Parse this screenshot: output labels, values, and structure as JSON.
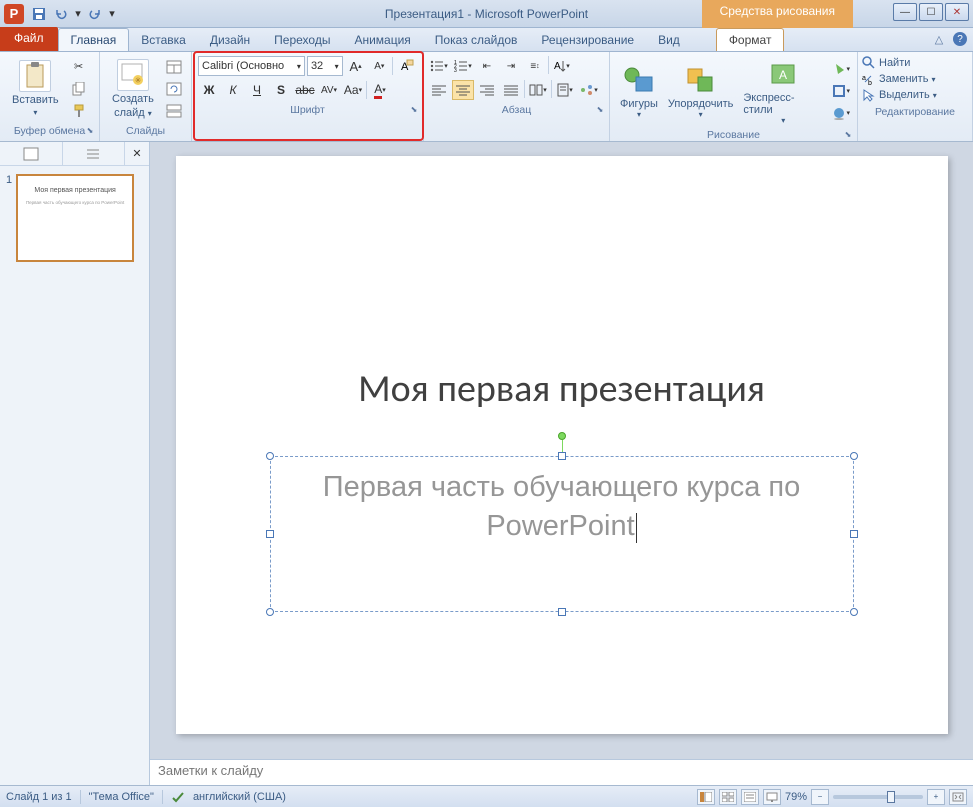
{
  "app_icon_letter": "P",
  "title": "Презентация1 - Microsoft PowerPoint",
  "context_tab": "Средства рисования",
  "tabs": {
    "file": "Файл",
    "list": [
      "Главная",
      "Вставка",
      "Дизайн",
      "Переходы",
      "Анимация",
      "Показ слайдов",
      "Рецензирование",
      "Вид"
    ],
    "format": "Формат"
  },
  "groups": {
    "clipboard": {
      "label": "Буфер обмена",
      "paste": "Вставить"
    },
    "slides": {
      "label": "Слайды",
      "new": "Создать",
      "slide": "слайд"
    },
    "font": {
      "label": "Шрифт",
      "family": "Calibri (Основно",
      "size": "32",
      "bold": "Ж",
      "italic": "К",
      "underline": "Ч",
      "strike": "abc",
      "shadow": "S",
      "spacing": "AV",
      "case": "Aa",
      "grow": "A",
      "shrink": "A",
      "clear": "A"
    },
    "paragraph": {
      "label": "Абзац"
    },
    "drawing": {
      "label": "Рисование",
      "shapes": "Фигуры",
      "arrange": "Упорядочить",
      "styles": "Экспресс-стили"
    },
    "editing": {
      "label": "Редактирование",
      "find": "Найти",
      "replace": "Заменить",
      "select": "Выделить"
    }
  },
  "slide": {
    "title": "Моя первая презентация",
    "subtitle": "Первая часть обучающего курса по PowerPoint"
  },
  "thumb": {
    "num": "1",
    "title": "Моя первая презентация",
    "sub": "Первая часть обучающего курса по PowerPoint"
  },
  "notes_placeholder": "Заметки к слайду",
  "status": {
    "slide": "Слайд 1 из 1",
    "theme": "\"Тема Office\"",
    "lang": "английский (США)",
    "zoom": "79%"
  }
}
